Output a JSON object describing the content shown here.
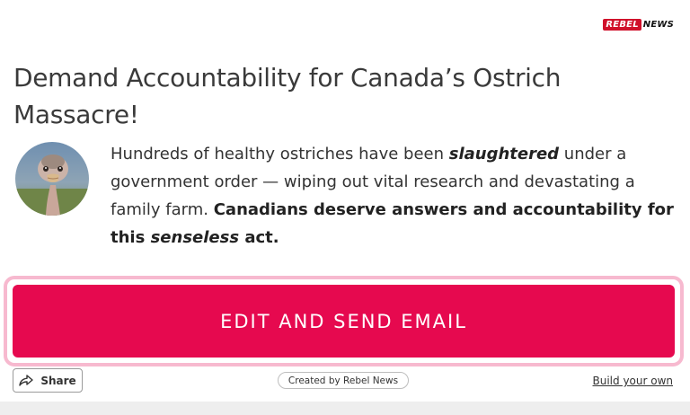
{
  "brand": {
    "logo_rebel": "REBEL",
    "logo_news": "NEWS",
    "accent_color": "#d0112b"
  },
  "campaign": {
    "title": "Demand Accountability for Canada’s Ostrich Massacre!",
    "description": {
      "p1": "Hundreds of healthy ostriches have been ",
      "p1_em": "slaughtered",
      "p2": " under a government order — wiping out vital research and devastating a family farm. ",
      "p3_bold": "Canadians deserve answers and accountability for this ",
      "p3_bold_em": "senseless",
      "p4_bold": " act."
    },
    "avatar_icon": "ostrich-photo"
  },
  "cta": {
    "label": "EDIT AND SEND EMAIL",
    "color": "#e6094f",
    "outline_color": "#f7b9cf"
  },
  "footer": {
    "share_label": "Share",
    "share_icon": "share-arrow-icon",
    "created_by": "Created by Rebel News",
    "build_link": "Build your own"
  }
}
